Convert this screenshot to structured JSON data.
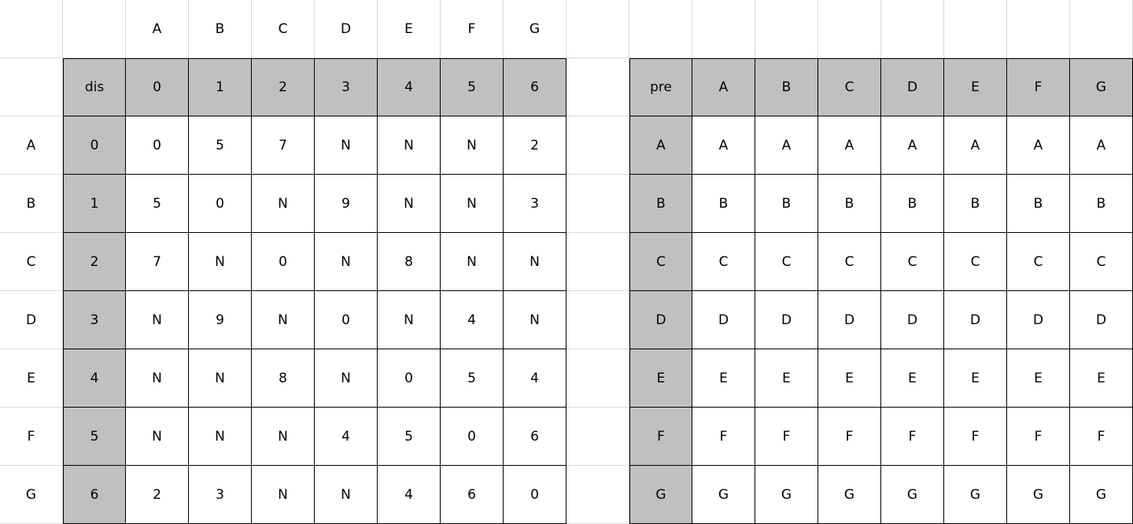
{
  "colors": {
    "header_fill": "#c0c0c0",
    "gridline": "#d9d9d9",
    "table_border": "#000000"
  },
  "top_header_letters": [
    "A",
    "B",
    "C",
    "D",
    "E",
    "F",
    "G"
  ],
  "row_labels": [
    "A",
    "B",
    "C",
    "D",
    "E",
    "F",
    "G"
  ],
  "dis_table": {
    "corner_label": "dis",
    "column_headers": [
      "0",
      "1",
      "2",
      "3",
      "4",
      "5",
      "6"
    ],
    "row_headers": [
      "0",
      "1",
      "2",
      "3",
      "4",
      "5",
      "6"
    ],
    "rows": [
      [
        "0",
        "5",
        "7",
        "N",
        "N",
        "N",
        "2"
      ],
      [
        "5",
        "0",
        "N",
        "9",
        "N",
        "N",
        "3"
      ],
      [
        "7",
        "N",
        "0",
        "N",
        "8",
        "N",
        "N"
      ],
      [
        "N",
        "9",
        "N",
        "0",
        "N",
        "4",
        "N"
      ],
      [
        "N",
        "N",
        "8",
        "N",
        "0",
        "5",
        "4"
      ],
      [
        "N",
        "N",
        "N",
        "4",
        "5",
        "0",
        "6"
      ],
      [
        "2",
        "3",
        "N",
        "N",
        "4",
        "6",
        "0"
      ]
    ]
  },
  "pre_table": {
    "corner_label": "pre",
    "column_headers": [
      "A",
      "B",
      "C",
      "D",
      "E",
      "F",
      "G"
    ],
    "row_headers": [
      "A",
      "B",
      "C",
      "D",
      "E",
      "F",
      "G"
    ],
    "rows": [
      [
        "A",
        "A",
        "A",
        "A",
        "A",
        "A",
        "A"
      ],
      [
        "B",
        "B",
        "B",
        "B",
        "B",
        "B",
        "B"
      ],
      [
        "C",
        "C",
        "C",
        "C",
        "C",
        "C",
        "C"
      ],
      [
        "D",
        "D",
        "D",
        "D",
        "D",
        "D",
        "D"
      ],
      [
        "E",
        "E",
        "E",
        "E",
        "E",
        "E",
        "E"
      ],
      [
        "F",
        "F",
        "F",
        "F",
        "F",
        "F",
        "F"
      ],
      [
        "G",
        "G",
        "G",
        "G",
        "G",
        "G",
        "G"
      ]
    ]
  }
}
